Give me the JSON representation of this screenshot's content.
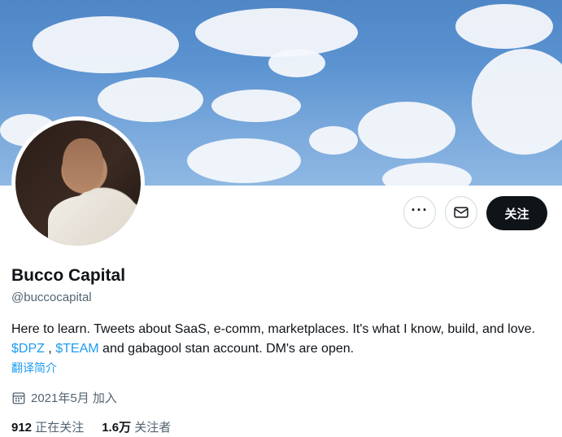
{
  "profile": {
    "name": "Bucco Capital",
    "handle": "@buccocapital",
    "bio_part1": "Here to learn. Tweets about SaaS, e-comm, marketplaces. It's what I know, build, and love.",
    "bio_link1": "$DPZ",
    "bio_sep": " , ",
    "bio_link2": "$TEAM",
    "bio_part2": " and gabagool stan account. DM's are open.",
    "translate_label": "翻译简介",
    "joined_label": "2021年5月 加入",
    "following_count": "912",
    "following_label": "正在关注",
    "followers_count": "1.6万",
    "followers_label": "关注者"
  },
  "actions": {
    "more_label": "···",
    "follow_label": "关注"
  },
  "icons": {
    "more": "more-dots-icon",
    "message": "envelope-icon",
    "calendar": "calendar-icon"
  },
  "colors": {
    "link": "#1d9bf0",
    "follow_bg": "#0f1419",
    "muted": "#536471"
  }
}
